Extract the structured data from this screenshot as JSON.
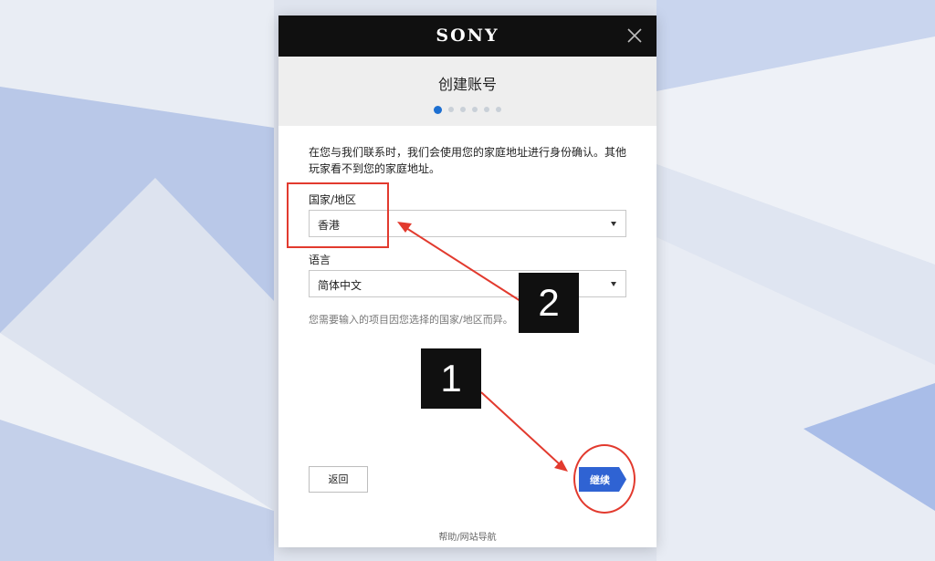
{
  "brand": {
    "logo_text": "SONY"
  },
  "dialog": {
    "title": "创建账号",
    "steps_total": 6,
    "current_step": 1,
    "description": "在您与我们联系时，我们会使用您的家庭地址进行身份确认。其他玩家看不到您的家庭地址。",
    "country": {
      "label": "国家/地区",
      "value": "香港"
    },
    "language": {
      "label": "语言",
      "value": "简体中文"
    },
    "hint": "您需要输入的项目因您选择的国家/地区而异。",
    "back_button": "返回",
    "continue_button": "继续",
    "footer_link": "帮助/网站导航"
  },
  "annotations": {
    "badge_1": "1",
    "badge_2": "2"
  },
  "colors": {
    "accent_blue": "#2f63d3",
    "step_active": "#1d6fd1",
    "annotation_red": "#e23a2e",
    "header_black": "#101010"
  },
  "icons": {
    "close": "close-icon",
    "dropdown": "caret-down-icon"
  }
}
